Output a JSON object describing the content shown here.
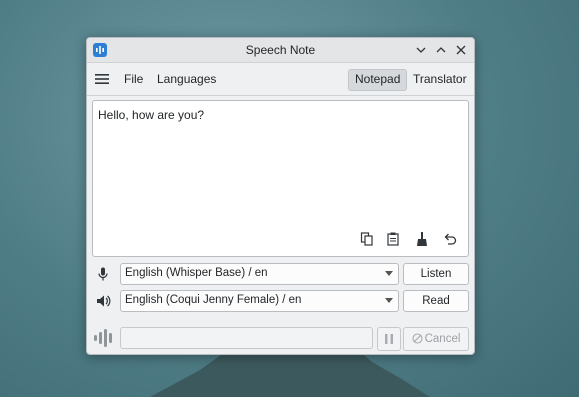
{
  "window": {
    "title": "Speech Note",
    "controls": [
      "minimize-icon",
      "maximize-icon",
      "close-icon"
    ]
  },
  "menu": {
    "file": "File",
    "languages": "Languages"
  },
  "tabs": {
    "notepad": "Notepad",
    "translator": "Translator",
    "active": "Notepad"
  },
  "note": {
    "text": "Hello, how are you?"
  },
  "text_tools": [
    "copy-icon",
    "paste-icon",
    "clear-icon",
    "undo-icon"
  ],
  "stt": {
    "model": "English (Whisper Base) / en",
    "action": "Listen"
  },
  "tts": {
    "model": "English (Coqui Jenny Female) / en",
    "action": "Read"
  },
  "status": {
    "cancel": "Cancel"
  },
  "colors": {
    "accent": "#2d7fd6",
    "window_bg": "#eff0f1"
  }
}
